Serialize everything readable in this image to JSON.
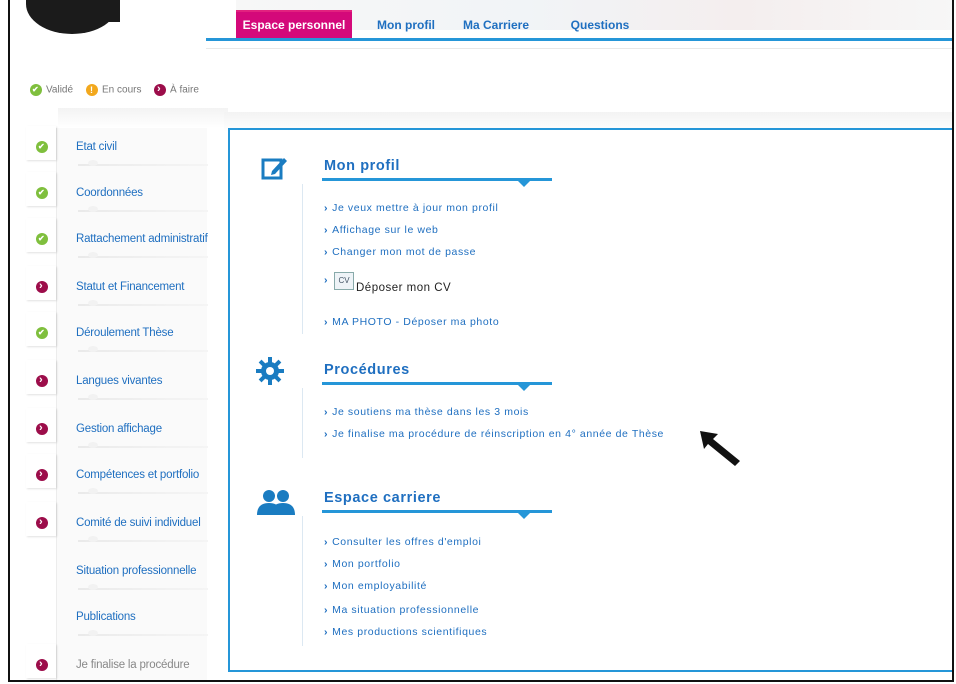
{
  "top_nav": {
    "tabs": [
      {
        "label": "Espace personnel",
        "active": true
      },
      {
        "label": "Mon profil",
        "active": false
      },
      {
        "label": "Ma Carriere",
        "active": false
      },
      {
        "label": "Questions",
        "active": false
      }
    ]
  },
  "legend": {
    "items": [
      {
        "label": "Validé",
        "status": "green"
      },
      {
        "label": "En cours",
        "status": "orange"
      },
      {
        "label": "À faire",
        "status": "purple"
      }
    ]
  },
  "sidebar": {
    "items": [
      {
        "label": "Etat civil",
        "status": "green"
      },
      {
        "label": "Coordonnées",
        "status": "green"
      },
      {
        "label": "Rattachement administratif",
        "status": "green"
      },
      {
        "label": "Statut et Financement",
        "status": "purple"
      },
      {
        "label": "Déroulement Thèse",
        "status": "green"
      },
      {
        "label": "Langues vivantes",
        "status": "purple"
      },
      {
        "label": "Gestion affichage",
        "status": "purple"
      },
      {
        "label": "Compétences et portfolio",
        "status": "purple"
      },
      {
        "label": "Comité de suivi individuel",
        "status": "purple"
      },
      {
        "label": "Situation professionnelle",
        "status": "none"
      },
      {
        "label": "Publications",
        "status": "none"
      },
      {
        "label": "Je finalise la procédure",
        "status": "purple"
      }
    ]
  },
  "main": {
    "mon_profil": {
      "title": "Mon profil",
      "links": [
        "Je veux mettre à jour mon profil",
        "Affichage sur le web",
        "Changer mon mot de passe"
      ],
      "cv_label": "Déposer mon CV",
      "photo_link": "MA PHOTO - Déposer ma photo"
    },
    "procedures": {
      "title": "Procédures",
      "links": [
        "Je soutiens ma thèse dans les 3 mois",
        "Je finalise ma procédure de réinscription en 4° année de Thèse"
      ]
    },
    "espace_carriere": {
      "title": "Espace carriere",
      "links": [
        "Consulter les offres d'emploi",
        "Mon portfolio",
        "Mon employabilité",
        "Ma situation professionnelle",
        "Mes productions scientifiques"
      ]
    }
  },
  "colors": {
    "accent_blue": "#2596d8",
    "link_blue": "#1f6fc0",
    "active_tab": "#d4097a",
    "status_green": "#7fbf3d",
    "status_orange": "#f2a81d",
    "status_purple": "#9c0d4a"
  }
}
